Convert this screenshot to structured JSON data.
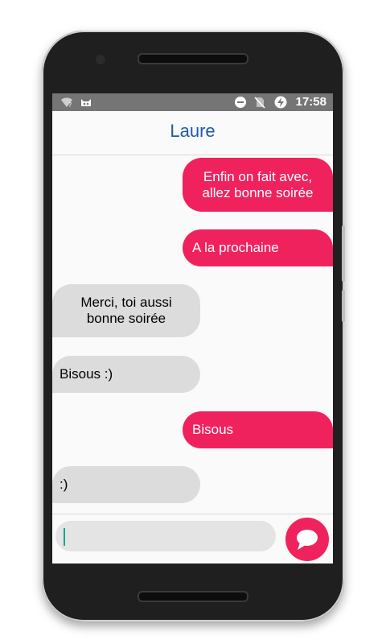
{
  "status_bar": {
    "time": "17:58",
    "icons": [
      "wifi-unknown-icon",
      "android-cat-icon",
      "do-not-disturb-icon",
      "no-sim-icon",
      "battery-charging-icon"
    ]
  },
  "header": {
    "title": "Laure"
  },
  "messages": [
    {
      "direction": "sent",
      "text": "Enfin on fait avec,\nallez bonne soirée"
    },
    {
      "direction": "sent",
      "text": "A la prochaine"
    },
    {
      "direction": "received",
      "text": "Merci, toi aussi\nbonne soirée"
    },
    {
      "direction": "received",
      "text": "Bisous :)"
    },
    {
      "direction": "sent",
      "text": "Bisous"
    },
    {
      "direction": "received",
      "text": ":)"
    }
  ],
  "composer": {
    "value": "",
    "send_icon": "chat-bubble-icon"
  },
  "colors": {
    "sent_bubble": "#f0225e",
    "received_bubble": "#dcdcdc",
    "title": "#1e5aa8",
    "status_bar": "#757575"
  }
}
